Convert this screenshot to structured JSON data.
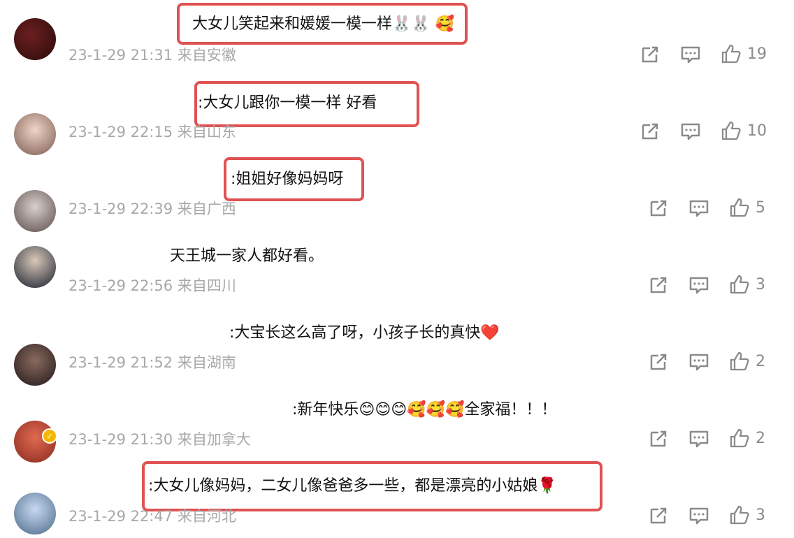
{
  "comments": [
    {
      "text": "大女儿笑起来和媛媛一模一样",
      "emoji": "🐰🐰 🥰",
      "time": "23-1-29 21:31",
      "location": "来自安徽",
      "likes": "19"
    },
    {
      "text": ":大女儿跟你一模一样 好看",
      "emoji": "",
      "time": "23-1-29 22:15",
      "location": "来自山东",
      "likes": "10"
    },
    {
      "text": ":姐姐好像妈妈呀",
      "emoji": "",
      "time": "23-1-29 22:39",
      "location": "来自广西",
      "likes": "5"
    },
    {
      "text": "天王城一家人都好看。",
      "emoji": "",
      "time": "23-1-29 22:56",
      "location": "来自四川",
      "likes": "3"
    },
    {
      "text": ":大宝长这么高了呀，小孩子长的真快",
      "emoji": "❤️",
      "time": "23-1-29 21:52",
      "location": "来自湖南",
      "likes": "2"
    },
    {
      "text": ":新年快乐",
      "emoji": "😊😊😊🥰🥰🥰",
      "text2": "全家福！！！",
      "time": "23-1-29 21:30",
      "location": "来自加拿大",
      "likes": "2"
    },
    {
      "text": ":大女儿像妈妈，二女儿像爸爸多一些，都是漂亮的小姑娘",
      "emoji": "🌹",
      "time": "23-1-29 22:47",
      "location": "来自河北",
      "likes": "3"
    }
  ],
  "colors": {
    "highlight": "#e05252",
    "meta": "#a8a8a8",
    "icon": "#8a8a8a",
    "verified": "#f5b800"
  },
  "icons": {
    "share": "share-icon",
    "comment": "comment-icon",
    "like": "thumbs-up-icon"
  }
}
